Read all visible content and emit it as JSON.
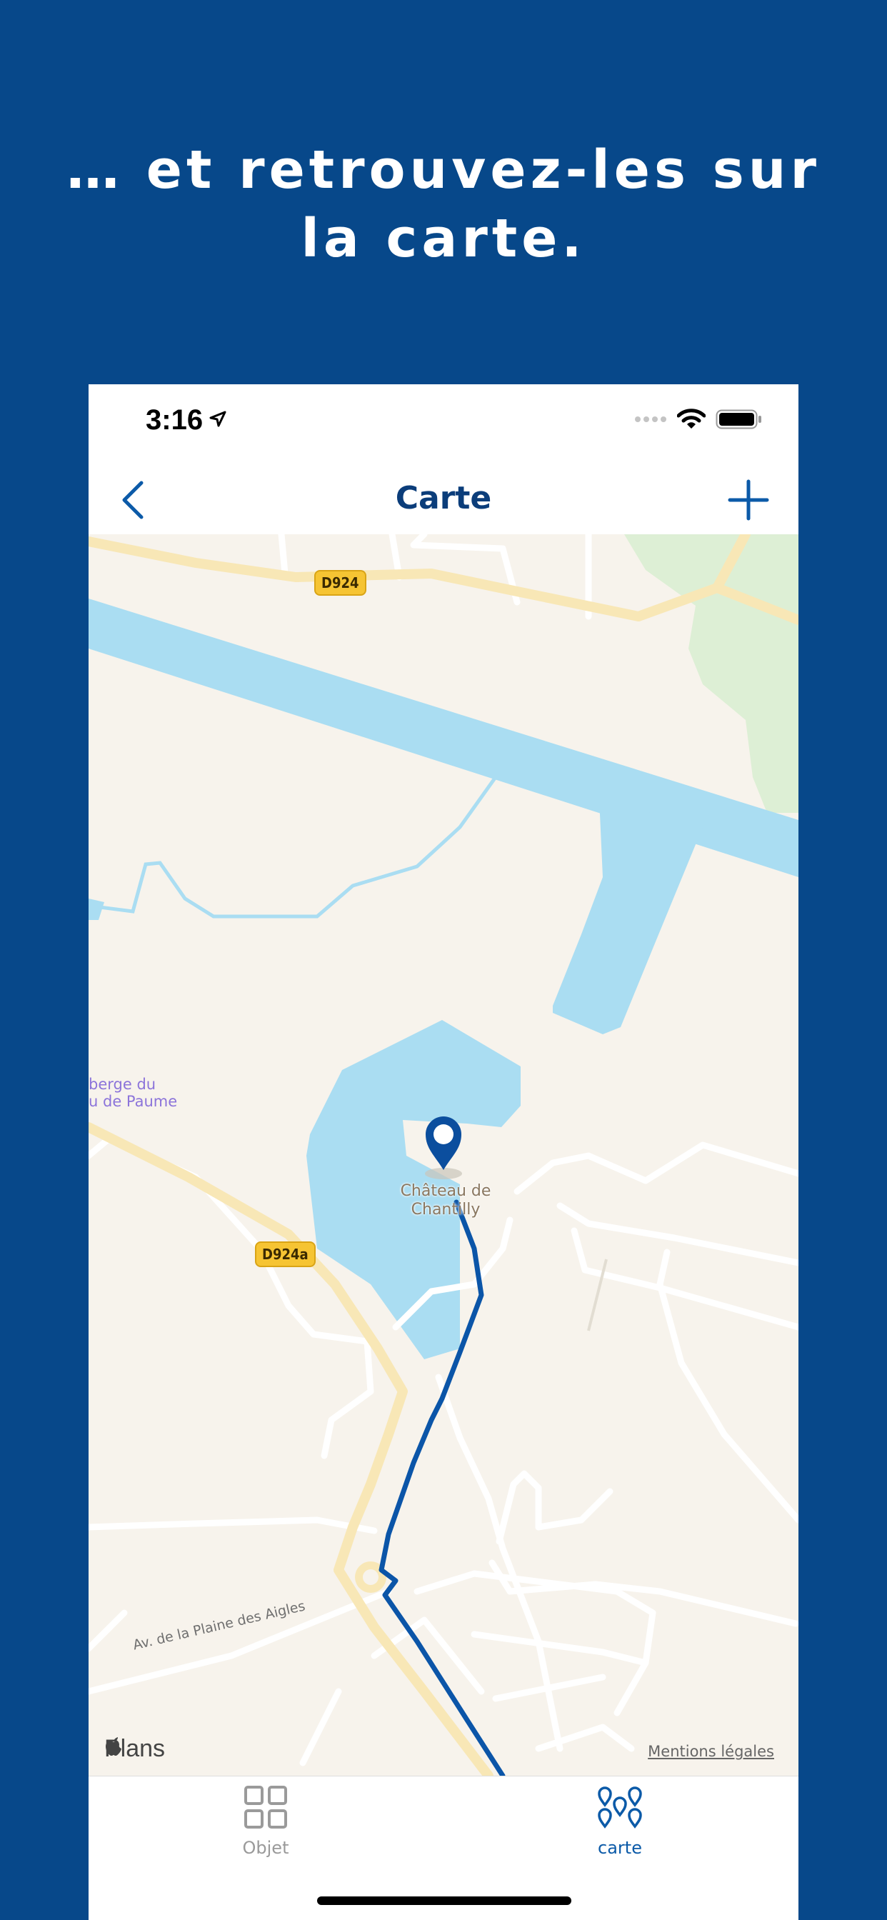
{
  "headline": {
    "line1": "… et retrouvez-les sur",
    "line2": "la carte."
  },
  "status_bar": {
    "time": "3:16"
  },
  "nav": {
    "title": "Carte"
  },
  "map": {
    "road_labels": [
      "D924",
      "D924a"
    ],
    "poi_name_line1": "Château de",
    "poi_name_line2": "Chantilly",
    "nearby_poi_line1": "berge du",
    "nearby_poi_line2": "u de Paume",
    "street_name": "Av. de la Plaine des Aigles",
    "provider": "Plans",
    "legal": "Mentions légales"
  },
  "tabs": [
    {
      "label": "Objet",
      "icon": "grid-icon",
      "active": false
    },
    {
      "label": "carte",
      "icon": "map-pins-icon",
      "active": true
    }
  ],
  "colors": {
    "background": "#07488A",
    "accent": "#0B5AA8",
    "water": "#AADDF2",
    "park": "#DDEFD5",
    "land": "#F7F3EC",
    "route": "#0B55A8"
  }
}
